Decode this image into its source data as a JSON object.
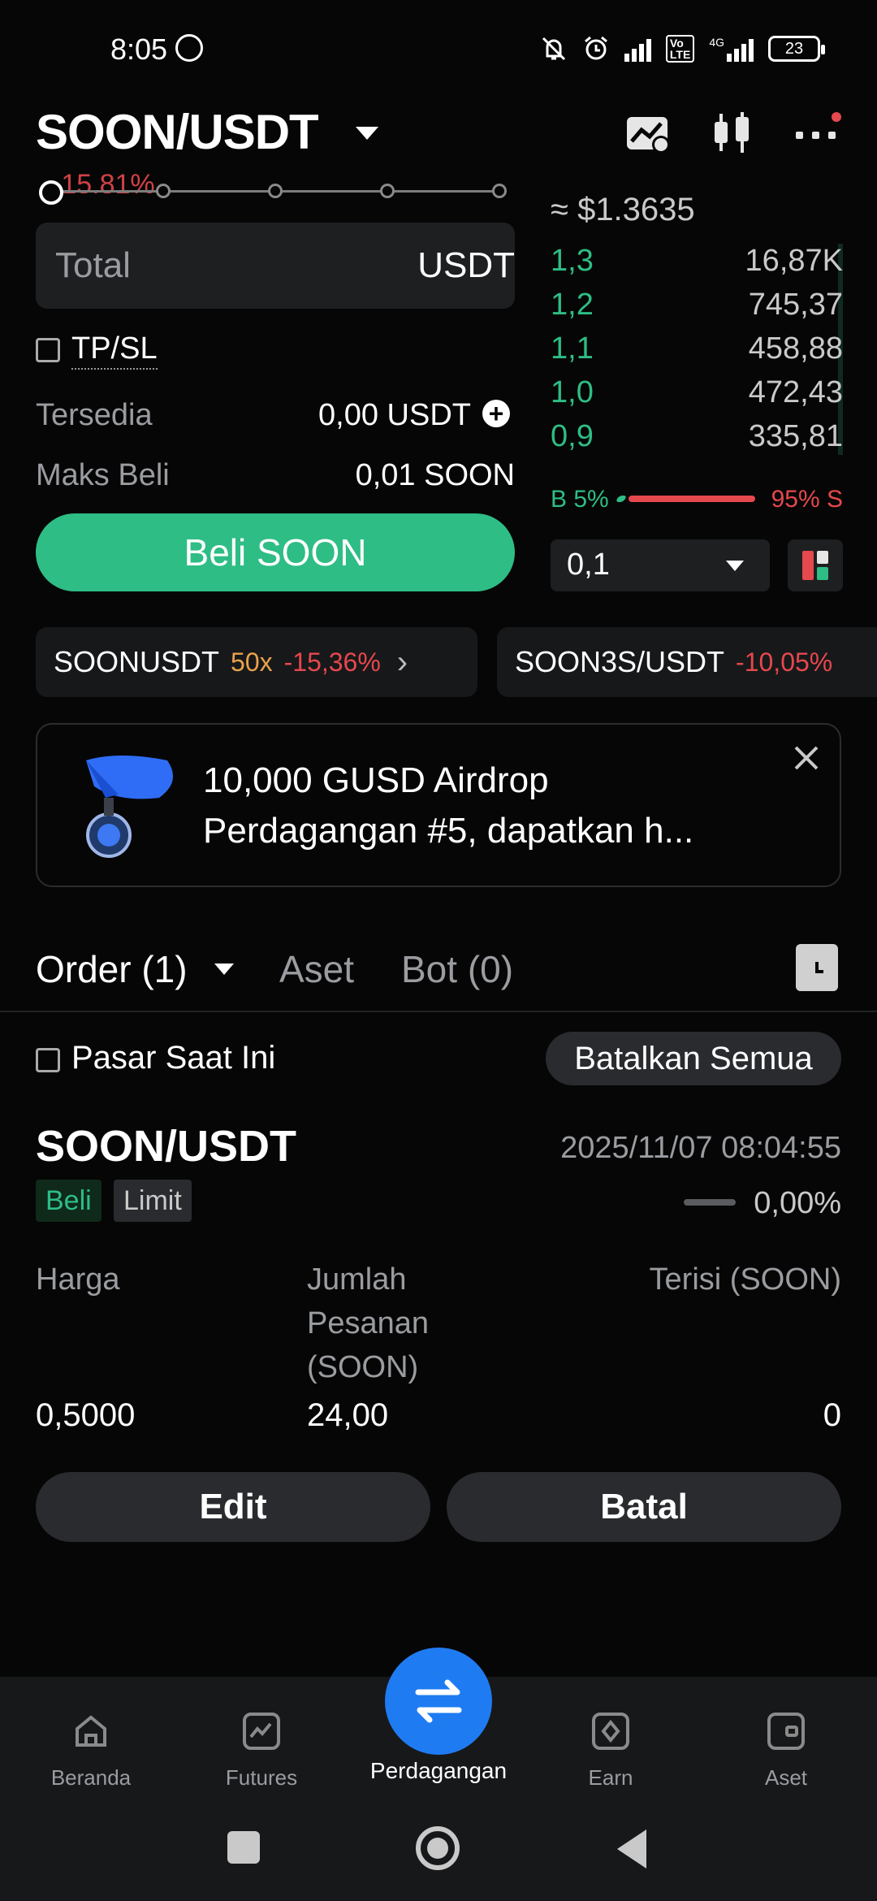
{
  "status_bar": {
    "time": "8:05",
    "battery": "23",
    "network": "4G"
  },
  "header": {
    "pair": "SOON/USDT"
  },
  "form": {
    "slider_pct_faded": "-15,81%",
    "total_label": "Total",
    "total_unit": "USDT",
    "tpsl_label": "TP/SL",
    "available_label": "Tersedia",
    "available_value": "0,00 USDT",
    "max_buy_label": "Maks Beli",
    "max_buy_value": "0,01 SOON",
    "buy_button": "Beli SOON"
  },
  "order_book": {
    "approx_price": "≈ $1.3635",
    "rows": [
      {
        "price": "1,3",
        "amount": "16,87K"
      },
      {
        "price": "1,2",
        "amount": "745,37"
      },
      {
        "price": "1,1",
        "amount": "458,88"
      },
      {
        "price": "1,0",
        "amount": "472,43"
      },
      {
        "price": "0,9",
        "amount": "335,81"
      }
    ],
    "buy_ratio": "B 5%",
    "sell_ratio": "95% S",
    "buy_ratio_value": 5,
    "depth_value": "0,1"
  },
  "tickers": [
    {
      "name": "SOONUSDT",
      "leverage": "50x",
      "change": "-15,36%"
    },
    {
      "name": "SOON3S/USDT",
      "change": "-10,05%"
    }
  ],
  "banner": {
    "line1": "10,000 GUSD Airdrop",
    "line2": "Perdagangan #5, dapatkan h..."
  },
  "tabs": {
    "order": "Order (1)",
    "asset": "Aset",
    "bot": "Bot (0)"
  },
  "orders_panel": {
    "current_market_label": "Pasar Saat Ini",
    "cancel_all": "Batalkan Semua"
  },
  "order": {
    "pair": "SOON/USDT",
    "time": "2025/11/07 08:04:55",
    "side": "Beli",
    "type": "Limit",
    "fill_pct": "0,00%",
    "col_price_label": "Harga",
    "col_qty_label_1": "Jumlah",
    "col_qty_label_2": "Pesanan",
    "col_qty_label_3": "(SOON)",
    "col_filled_label": "Terisi (SOON)",
    "price": "0,5000",
    "qty": "24,00",
    "filled": "0",
    "edit_button": "Edit",
    "cancel_button": "Batal"
  },
  "bottom_nav": [
    {
      "label": "Beranda",
      "icon": "home-icon"
    },
    {
      "label": "Futures",
      "icon": "chart-icon"
    },
    {
      "label": "Perdagangan",
      "icon": "swap-icon"
    },
    {
      "label": "Earn",
      "icon": "earn-icon"
    },
    {
      "label": "Aset",
      "icon": "wallet-icon"
    }
  ],
  "colors": {
    "buy": "#2ebd85",
    "sell": "#e5484d",
    "accent": "#1f7bf2",
    "leverage": "#e8a24a"
  }
}
